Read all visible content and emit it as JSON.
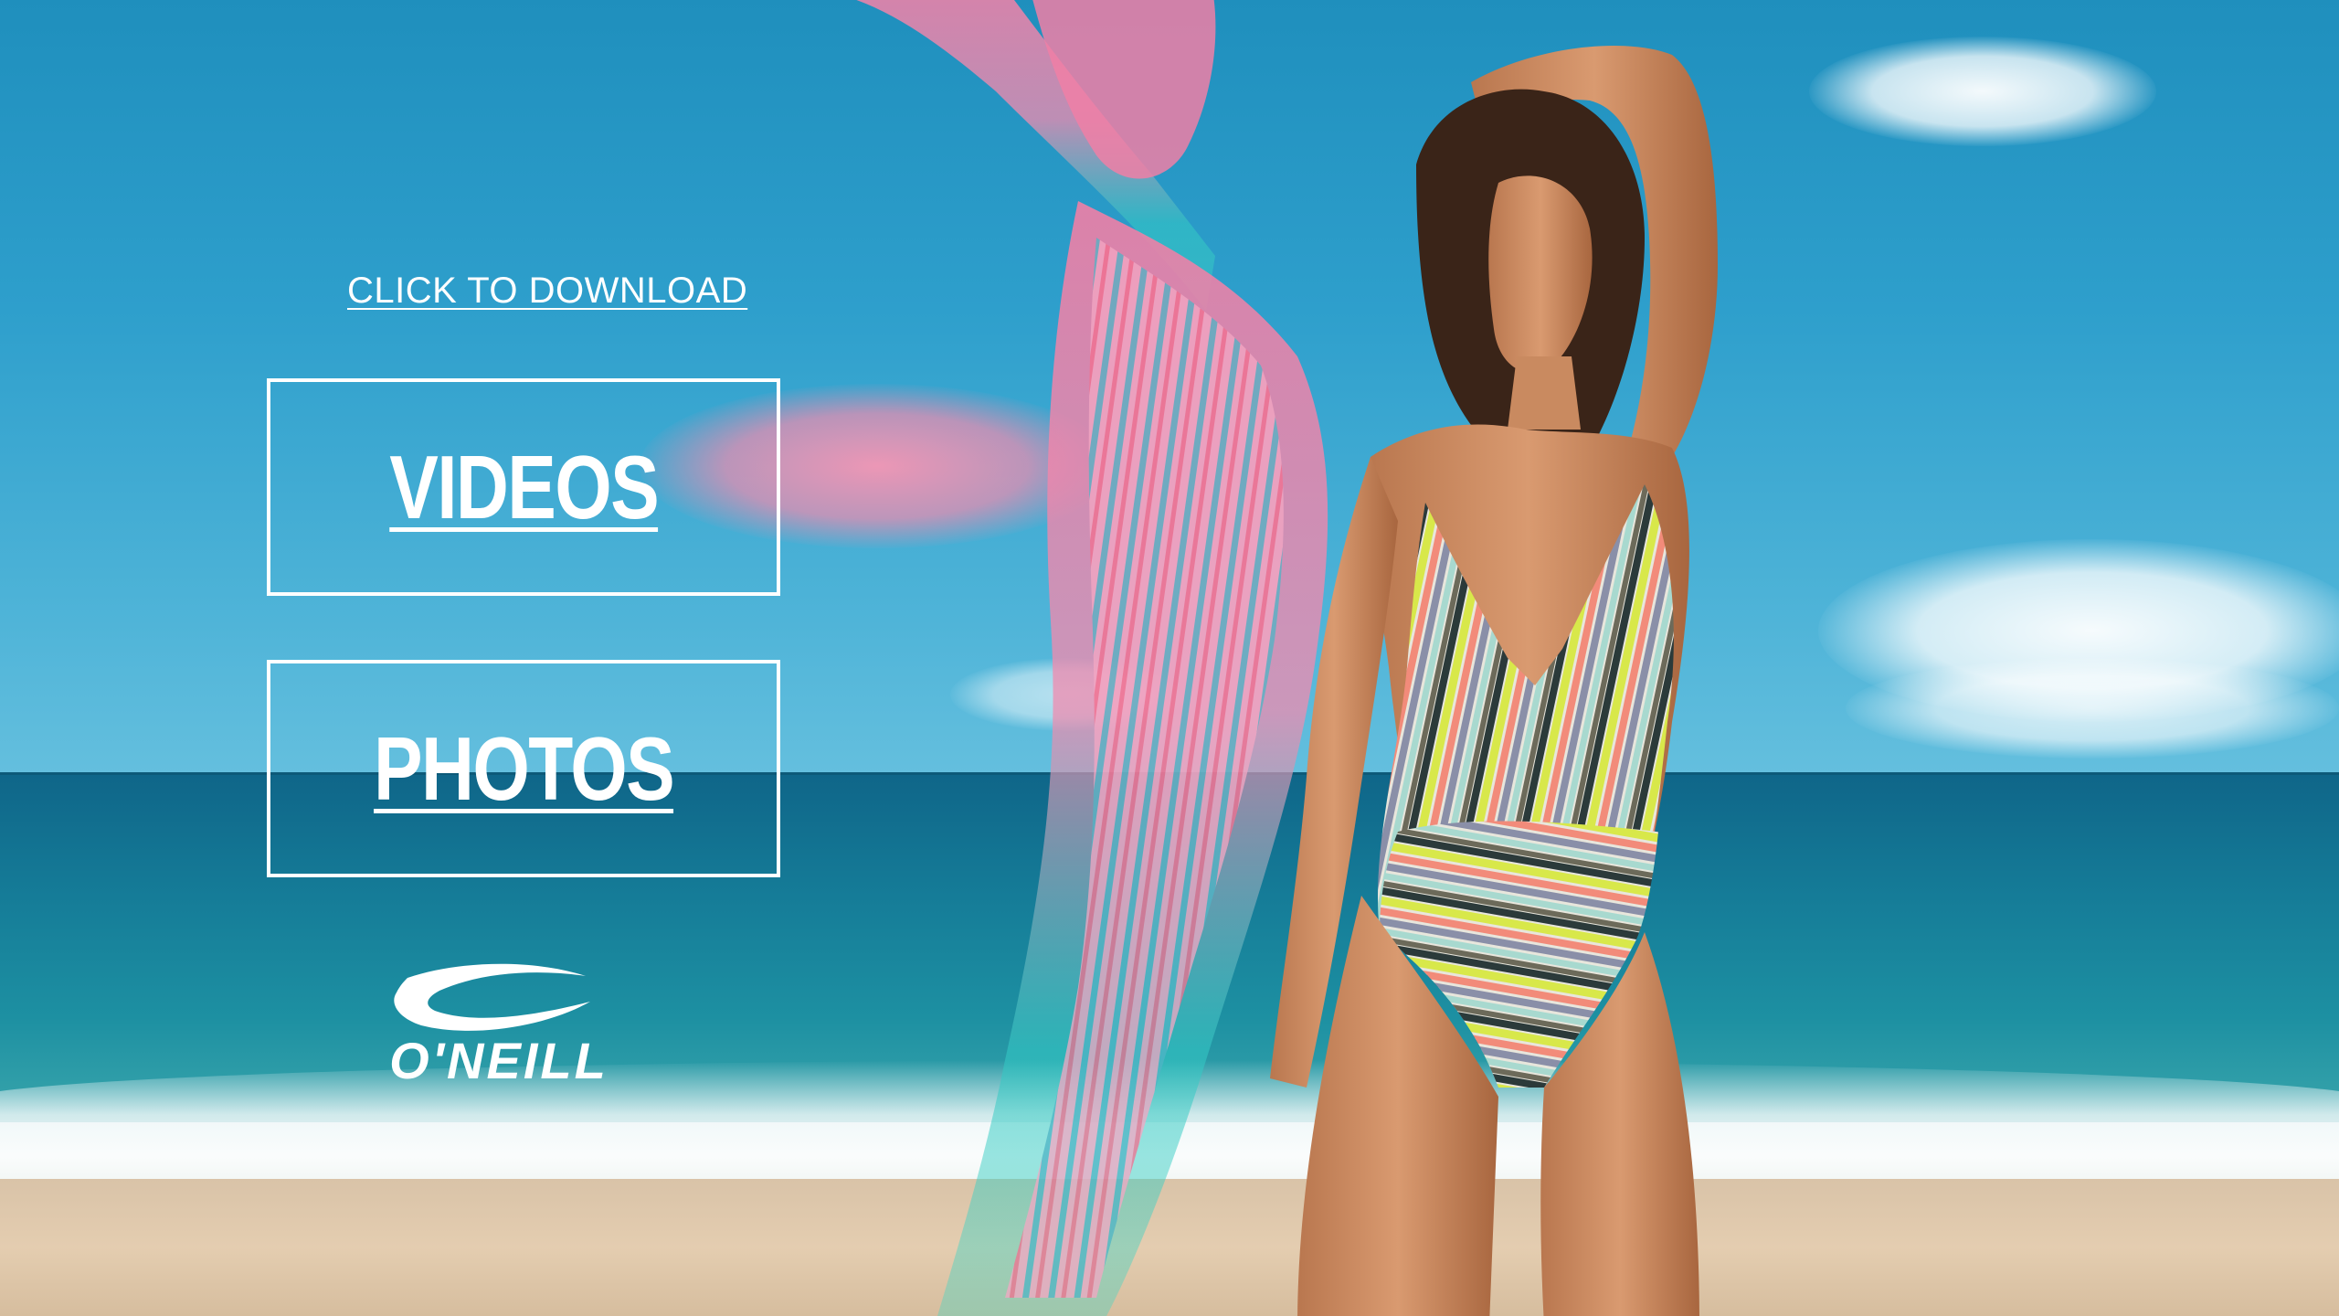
{
  "page": {
    "download_link": "CLICK TO DOWNLOAD",
    "nav": {
      "videos_label": "VIDEOS",
      "photos_label": "PHOTOS"
    },
    "brand": {
      "logo_name": "O'NEILL",
      "logo_icon": "wave-logo-icon"
    }
  },
  "scene": {
    "background": "beach-ocean-sky-photo",
    "subject": "model-in-striped-swimsuit",
    "overlay": "pink-teal-double-exposure"
  },
  "colors": {
    "ui_text": "#ffffff",
    "sky": "#2e9fcc",
    "sea": "#157c98",
    "sand": "#e4cdb0",
    "overlay_pink": "#f08cb0",
    "overlay_teal": "#39d3c4"
  }
}
